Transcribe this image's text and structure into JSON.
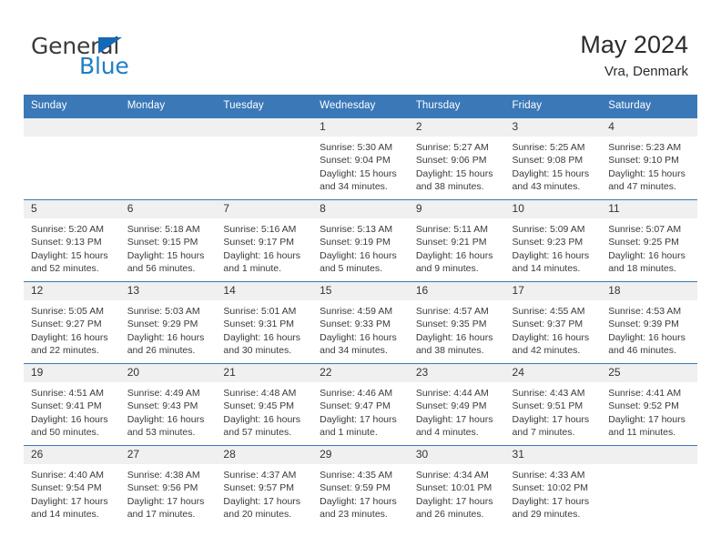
{
  "brand": {
    "name_part1": "General",
    "name_part2": "Blue",
    "triangle_color": "#1669b5",
    "blue_text_color": "#1f7ec4"
  },
  "header": {
    "title": "May 2024",
    "subtitle": "Vra, Denmark"
  },
  "theme": {
    "header_row_bg": "#3a78b8",
    "header_row_text": "#ffffff",
    "daynum_bg": "#f0f0f0",
    "grid_line": "#3a78b8"
  },
  "weekdays": [
    "Sunday",
    "Monday",
    "Tuesday",
    "Wednesday",
    "Thursday",
    "Friday",
    "Saturday"
  ],
  "labels": {
    "sunrise_prefix": "Sunrise:",
    "sunset_prefix": "Sunset:",
    "daylight_prefix": "Daylight:"
  },
  "weeks": [
    [
      {
        "day": "",
        "empty": true
      },
      {
        "day": "",
        "empty": true
      },
      {
        "day": "",
        "empty": true
      },
      {
        "day": "1",
        "sunrise": "Sunrise: 5:30 AM",
        "sunset": "Sunset: 9:04 PM",
        "daylight_line1": "Daylight: 15 hours",
        "daylight_line2": "and 34 minutes."
      },
      {
        "day": "2",
        "sunrise": "Sunrise: 5:27 AM",
        "sunset": "Sunset: 9:06 PM",
        "daylight_line1": "Daylight: 15 hours",
        "daylight_line2": "and 38 minutes."
      },
      {
        "day": "3",
        "sunrise": "Sunrise: 5:25 AM",
        "sunset": "Sunset: 9:08 PM",
        "daylight_line1": "Daylight: 15 hours",
        "daylight_line2": "and 43 minutes."
      },
      {
        "day": "4",
        "sunrise": "Sunrise: 5:23 AM",
        "sunset": "Sunset: 9:10 PM",
        "daylight_line1": "Daylight: 15 hours",
        "daylight_line2": "and 47 minutes."
      }
    ],
    [
      {
        "day": "5",
        "sunrise": "Sunrise: 5:20 AM",
        "sunset": "Sunset: 9:13 PM",
        "daylight_line1": "Daylight: 15 hours",
        "daylight_line2": "and 52 minutes."
      },
      {
        "day": "6",
        "sunrise": "Sunrise: 5:18 AM",
        "sunset": "Sunset: 9:15 PM",
        "daylight_line1": "Daylight: 15 hours",
        "daylight_line2": "and 56 minutes."
      },
      {
        "day": "7",
        "sunrise": "Sunrise: 5:16 AM",
        "sunset": "Sunset: 9:17 PM",
        "daylight_line1": "Daylight: 16 hours",
        "daylight_line2": "and 1 minute."
      },
      {
        "day": "8",
        "sunrise": "Sunrise: 5:13 AM",
        "sunset": "Sunset: 9:19 PM",
        "daylight_line1": "Daylight: 16 hours",
        "daylight_line2": "and 5 minutes."
      },
      {
        "day": "9",
        "sunrise": "Sunrise: 5:11 AM",
        "sunset": "Sunset: 9:21 PM",
        "daylight_line1": "Daylight: 16 hours",
        "daylight_line2": "and 9 minutes."
      },
      {
        "day": "10",
        "sunrise": "Sunrise: 5:09 AM",
        "sunset": "Sunset: 9:23 PM",
        "daylight_line1": "Daylight: 16 hours",
        "daylight_line2": "and 14 minutes."
      },
      {
        "day": "11",
        "sunrise": "Sunrise: 5:07 AM",
        "sunset": "Sunset: 9:25 PM",
        "daylight_line1": "Daylight: 16 hours",
        "daylight_line2": "and 18 minutes."
      }
    ],
    [
      {
        "day": "12",
        "sunrise": "Sunrise: 5:05 AM",
        "sunset": "Sunset: 9:27 PM",
        "daylight_line1": "Daylight: 16 hours",
        "daylight_line2": "and 22 minutes."
      },
      {
        "day": "13",
        "sunrise": "Sunrise: 5:03 AM",
        "sunset": "Sunset: 9:29 PM",
        "daylight_line1": "Daylight: 16 hours",
        "daylight_line2": "and 26 minutes."
      },
      {
        "day": "14",
        "sunrise": "Sunrise: 5:01 AM",
        "sunset": "Sunset: 9:31 PM",
        "daylight_line1": "Daylight: 16 hours",
        "daylight_line2": "and 30 minutes."
      },
      {
        "day": "15",
        "sunrise": "Sunrise: 4:59 AM",
        "sunset": "Sunset: 9:33 PM",
        "daylight_line1": "Daylight: 16 hours",
        "daylight_line2": "and 34 minutes."
      },
      {
        "day": "16",
        "sunrise": "Sunrise: 4:57 AM",
        "sunset": "Sunset: 9:35 PM",
        "daylight_line1": "Daylight: 16 hours",
        "daylight_line2": "and 38 minutes."
      },
      {
        "day": "17",
        "sunrise": "Sunrise: 4:55 AM",
        "sunset": "Sunset: 9:37 PM",
        "daylight_line1": "Daylight: 16 hours",
        "daylight_line2": "and 42 minutes."
      },
      {
        "day": "18",
        "sunrise": "Sunrise: 4:53 AM",
        "sunset": "Sunset: 9:39 PM",
        "daylight_line1": "Daylight: 16 hours",
        "daylight_line2": "and 46 minutes."
      }
    ],
    [
      {
        "day": "19",
        "sunrise": "Sunrise: 4:51 AM",
        "sunset": "Sunset: 9:41 PM",
        "daylight_line1": "Daylight: 16 hours",
        "daylight_line2": "and 50 minutes."
      },
      {
        "day": "20",
        "sunrise": "Sunrise: 4:49 AM",
        "sunset": "Sunset: 9:43 PM",
        "daylight_line1": "Daylight: 16 hours",
        "daylight_line2": "and 53 minutes."
      },
      {
        "day": "21",
        "sunrise": "Sunrise: 4:48 AM",
        "sunset": "Sunset: 9:45 PM",
        "daylight_line1": "Daylight: 16 hours",
        "daylight_line2": "and 57 minutes."
      },
      {
        "day": "22",
        "sunrise": "Sunrise: 4:46 AM",
        "sunset": "Sunset: 9:47 PM",
        "daylight_line1": "Daylight: 17 hours",
        "daylight_line2": "and 1 minute."
      },
      {
        "day": "23",
        "sunrise": "Sunrise: 4:44 AM",
        "sunset": "Sunset: 9:49 PM",
        "daylight_line1": "Daylight: 17 hours",
        "daylight_line2": "and 4 minutes."
      },
      {
        "day": "24",
        "sunrise": "Sunrise: 4:43 AM",
        "sunset": "Sunset: 9:51 PM",
        "daylight_line1": "Daylight: 17 hours",
        "daylight_line2": "and 7 minutes."
      },
      {
        "day": "25",
        "sunrise": "Sunrise: 4:41 AM",
        "sunset": "Sunset: 9:52 PM",
        "daylight_line1": "Daylight: 17 hours",
        "daylight_line2": "and 11 minutes."
      }
    ],
    [
      {
        "day": "26",
        "sunrise": "Sunrise: 4:40 AM",
        "sunset": "Sunset: 9:54 PM",
        "daylight_line1": "Daylight: 17 hours",
        "daylight_line2": "and 14 minutes."
      },
      {
        "day": "27",
        "sunrise": "Sunrise: 4:38 AM",
        "sunset": "Sunset: 9:56 PM",
        "daylight_line1": "Daylight: 17 hours",
        "daylight_line2": "and 17 minutes."
      },
      {
        "day": "28",
        "sunrise": "Sunrise: 4:37 AM",
        "sunset": "Sunset: 9:57 PM",
        "daylight_line1": "Daylight: 17 hours",
        "daylight_line2": "and 20 minutes."
      },
      {
        "day": "29",
        "sunrise": "Sunrise: 4:35 AM",
        "sunset": "Sunset: 9:59 PM",
        "daylight_line1": "Daylight: 17 hours",
        "daylight_line2": "and 23 minutes."
      },
      {
        "day": "30",
        "sunrise": "Sunrise: 4:34 AM",
        "sunset": "Sunset: 10:01 PM",
        "daylight_line1": "Daylight: 17 hours",
        "daylight_line2": "and 26 minutes."
      },
      {
        "day": "31",
        "sunrise": "Sunrise: 4:33 AM",
        "sunset": "Sunset: 10:02 PM",
        "daylight_line1": "Daylight: 17 hours",
        "daylight_line2": "and 29 minutes."
      },
      {
        "day": "",
        "empty": true
      }
    ]
  ]
}
